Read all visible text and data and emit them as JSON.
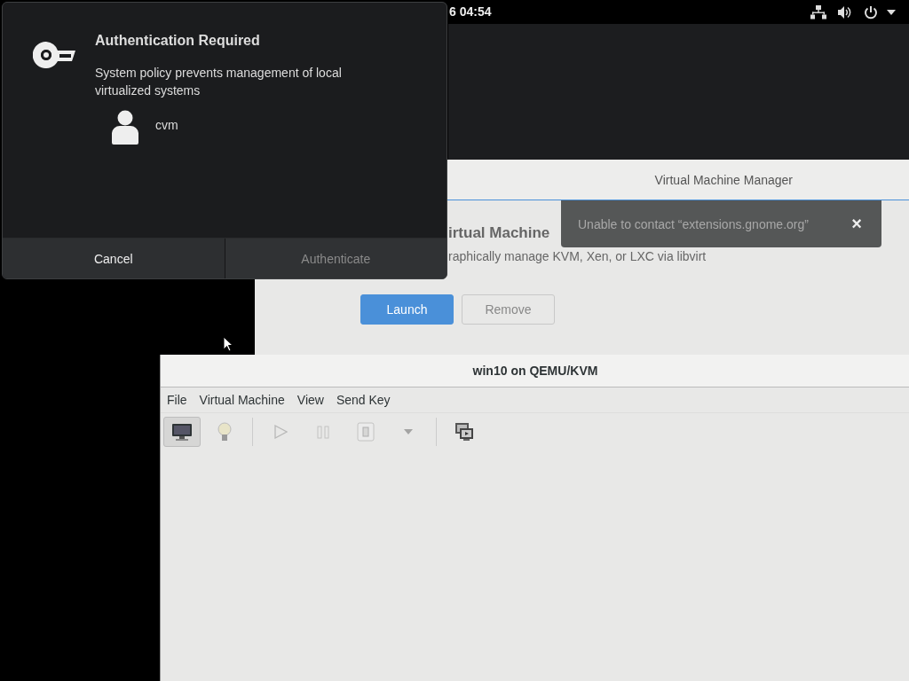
{
  "top_bar": {
    "clock": "6 04:54"
  },
  "software_window": {
    "title": "Virtual Machine Manager",
    "app_name": "irtual Machine",
    "summary": "raphically manage KVM, Xen, or LXC via libvirt",
    "buttons": [
      {
        "label": "Launch",
        "kind": "primary"
      },
      {
        "label": "Remove",
        "kind": "normal"
      }
    ]
  },
  "notification": {
    "message": "Unable to contact “extensions.gnome.org”",
    "close": "×"
  },
  "auth_dialog": {
    "title": "Authentication Required",
    "message": "System policy prevents management of local virtualized systems",
    "user": "cvm",
    "buttons": [
      {
        "label": "Cancel",
        "disabled": false
      },
      {
        "label": "Authenticate",
        "disabled": true
      }
    ]
  },
  "viewer_window": {
    "title": "win10 on QEMU/KVM",
    "menu": [
      "File",
      "Virtual Machine",
      "View",
      "Send Key"
    ],
    "toolbar": [
      {
        "kind": "console",
        "selected": true,
        "disabled": false
      },
      {
        "kind": "details",
        "selected": false,
        "disabled": false
      },
      {
        "kind": "separator"
      },
      {
        "kind": "run",
        "selected": false,
        "disabled": true
      },
      {
        "kind": "pause",
        "selected": false,
        "disabled": true
      },
      {
        "kind": "shutdown",
        "selected": false,
        "disabled": true
      },
      {
        "kind": "menu",
        "selected": false,
        "disabled": true
      },
      {
        "kind": "separator"
      },
      {
        "kind": "fullscreen",
        "selected": false,
        "disabled": false
      }
    ]
  }
}
